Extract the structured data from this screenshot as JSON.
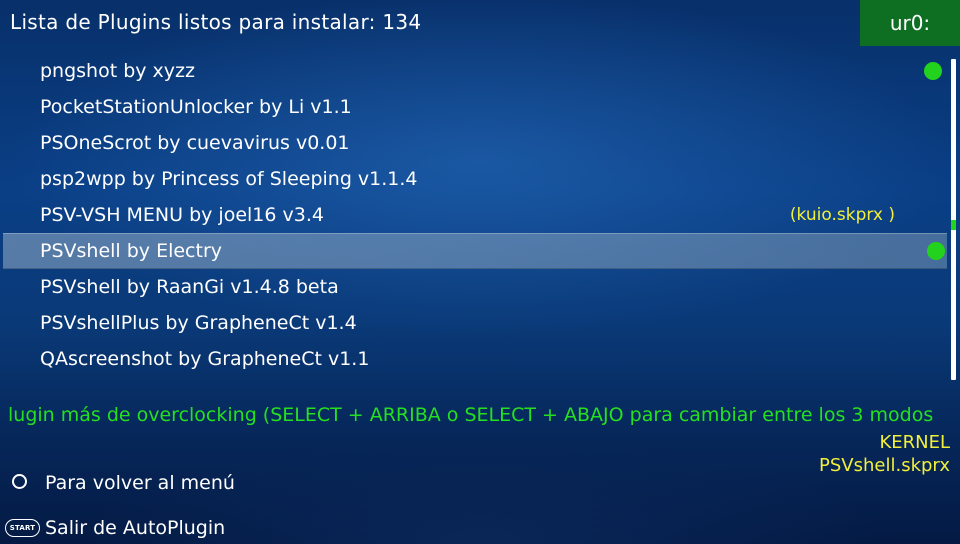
{
  "header": {
    "title": "Lista de Plugins listos para instalar: 134",
    "partition": "ur0:"
  },
  "plugins": [
    {
      "label": "pngshot by xyzz",
      "installed": true,
      "note": ""
    },
    {
      "label": "PocketStationUnlocker by Li  v1.1",
      "installed": false,
      "note": ""
    },
    {
      "label": "PSOneScrot by cuevavirus  v0.01",
      "installed": false,
      "note": ""
    },
    {
      "label": "psp2wpp by Princess of Sleeping  v1.1.4",
      "installed": false,
      "note": ""
    },
    {
      "label": "PSV-VSH MENU by joel16  v3.4",
      "installed": false,
      "note": "(kuio.skprx )"
    },
    {
      "label": "PSVshell by Electry",
      "installed": true,
      "note": "",
      "selected": true
    },
    {
      "label": "PSVshell by RaanGi  v1.4.8 beta",
      "installed": false,
      "note": ""
    },
    {
      "label": "PSVshellPlus by GrapheneCt  v1.4",
      "installed": false,
      "note": ""
    },
    {
      "label": "QAscreenshot by GrapheneCt  v1.1",
      "installed": false,
      "note": ""
    }
  ],
  "description": "lugin más de overclocking (SELECT + ARRIBA o SELECT + ABAJO para cambiar entre los 3 modos",
  "install_info": {
    "section": "KERNEL",
    "file": "PSVshell.skprx"
  },
  "footer": {
    "back_label": "Para volver al menú",
    "back_icon": "circle-button-icon",
    "exit_label": "Salir de AutoPlugin",
    "exit_icon": "start-button-icon",
    "start_text": "START"
  },
  "colors": {
    "installed_dot": "#22d21c",
    "note_yellow": "#f2ef3a",
    "marquee_green": "#25e01f",
    "partition_badge": "#0e6e22"
  }
}
